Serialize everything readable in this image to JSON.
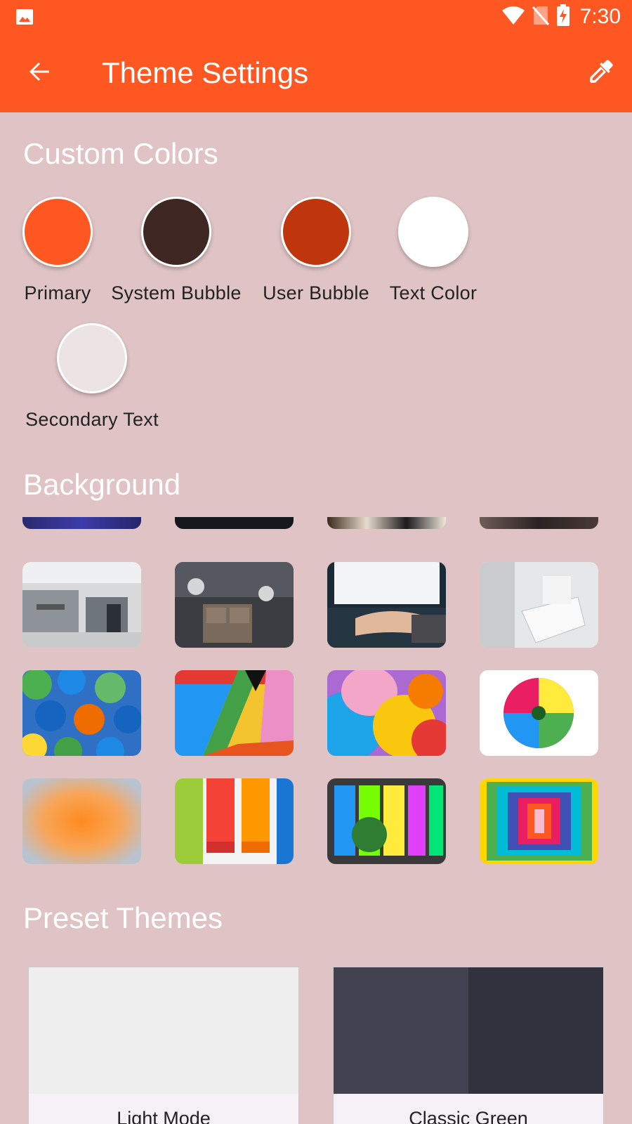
{
  "status_bar": {
    "time": "7:30",
    "icons": [
      "image-icon",
      "wifi-icon",
      "no-sim-icon",
      "battery-charging-icon"
    ]
  },
  "app_bar": {
    "title": "Theme Settings",
    "back_icon": "arrow-back-icon",
    "edit_icon": "eyedropper-icon",
    "color": "#ff5722"
  },
  "custom_colors": {
    "title": "Custom Colors",
    "swatches": [
      {
        "label": "Primary",
        "color": "#ff5722"
      },
      {
        "label": "System Bubble",
        "color": "#3e2723"
      },
      {
        "label": "User Bubble",
        "color": "#bf360c"
      },
      {
        "label": "Text Color",
        "color": "#ffffff"
      },
      {
        "label": "Secondary Text",
        "color": "#ebe3e4"
      }
    ]
  },
  "background": {
    "title": "Background",
    "images": [
      "factory-workers-image",
      "robot-toy-bricks-image",
      "laptop-typing-image",
      "robot-hand-image",
      "umbrellas-image",
      "colorful-brick-wall-image",
      "color-bubbles-image",
      "rainbow-flower-image",
      "orange-blur-image",
      "paint-rollers-image",
      "colorful-building-image",
      "rainbow-corridor-image"
    ]
  },
  "preset_themes": {
    "title": "Preset Themes",
    "themes": [
      {
        "label": "Light Mode",
        "colors": [
          "#eeeeee",
          "#eeeeee"
        ]
      },
      {
        "label": "Classic Green",
        "colors": [
          "#424250",
          "#32323e"
        ]
      }
    ]
  },
  "page_background": "#e0c4c5"
}
